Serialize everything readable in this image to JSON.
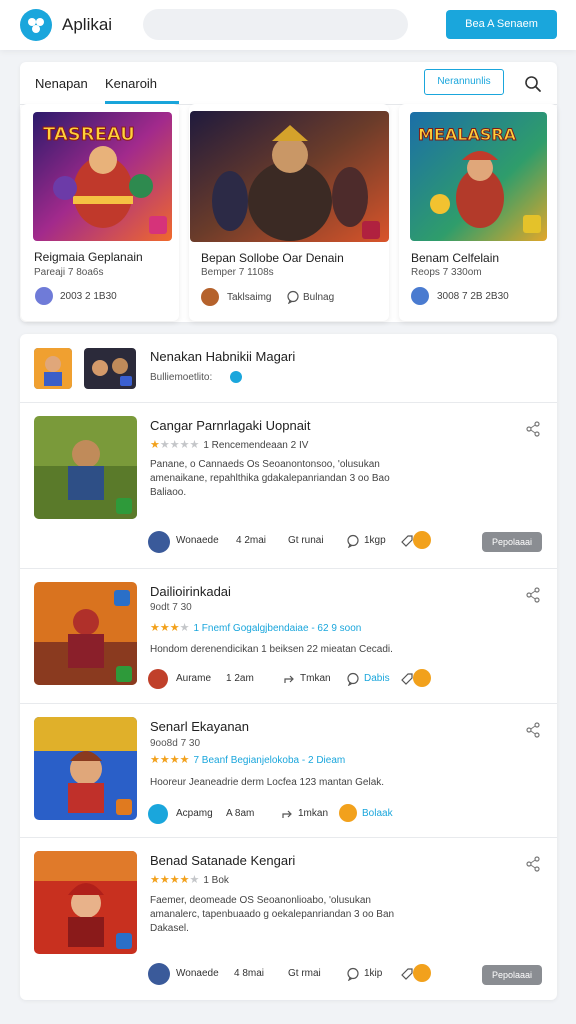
{
  "header": {
    "app_name": "Aplikai",
    "search_placeholder": "",
    "button_label": "Bea A Senaem"
  },
  "tabs": {
    "items": [
      "Nenapan",
      "Kenaroih"
    ],
    "active_index": 1,
    "filter_label": "Nerannunlis"
  },
  "featured": [
    {
      "img_text": "TASREAU",
      "title": "Reigmaia Geplanain",
      "sub": "Pareaji 7 8oa6s",
      "meta": "2003 2 1B30"
    },
    {
      "title": "Bepan Sollobe Oar Denain",
      "sub": "Bemper 7 1108s",
      "meta1": "Taklsaimg",
      "meta2": "Bulnag"
    },
    {
      "img_text": "MEALASRA",
      "title": "Benam Celfelain",
      "sub": "Reops 7 330om",
      "meta": "3008 7 2B 2B30"
    }
  ],
  "list_header": {
    "title": "Nenakan Habnikii Magari",
    "sub": "Bulliemoetlito:"
  },
  "rows": [
    {
      "title": "Cangar Parnrlagaki Uopnait",
      "rating": 1,
      "rating_text": "1 Rencemendeaan 2 IV",
      "rating_blue": false,
      "desc": "Panane, o Cannaeds Os Seoanontonsoo, 'olusukan amenaikane, repahlthika gdakalepanriandan 3 oo Bao Baliaoo.",
      "footer": [
        "Wonaede",
        "4 2mai",
        "Gt runai",
        "1kgp"
      ],
      "pill": "Pepolaaai"
    },
    {
      "title": "Dailioirinkadai",
      "sub": "9odt 7 30",
      "rating": 3,
      "rating_text": "1 Fnemf Gogalgjbendaiae - 62 9 soon",
      "rating_blue": true,
      "desc": "Hondom derenendicikan 1 beiksen 22 mieatan Cecadi.",
      "footer": [
        "Aurame",
        "1 2am",
        "Tmkan",
        "Dabis"
      ]
    },
    {
      "title": "Senarl Ekayanan",
      "sub": "9oo8d 7 30",
      "rating": 4,
      "rating_text": "7 Beanf Begianjelokoba - 2 Dieam",
      "rating_blue": true,
      "desc": "Hooreur Jeaneadrie derm Locfea 123 mantan Gelak.",
      "footer": [
        "Acpamg",
        "A 8am",
        "1mkan",
        "Bolaak"
      ]
    },
    {
      "title": "Benad Satanade Kengari",
      "rating": 4,
      "rating_text": "1 Bok",
      "rating_blue": false,
      "desc": "Faemer, deomeade OS Seoanonlioabo, 'olusukan amanalerc, tapenbuaado g oekalepanriandan 3 oo Ban Dakasel.",
      "footer": [
        "Wonaede",
        "4 8mai",
        "Gt rmai",
        "1kip"
      ],
      "pill": "Pepolaaai"
    }
  ],
  "colors": {
    "accent": "#1aa6dc",
    "star": "#f2a11c",
    "pill": "#8a8d92"
  }
}
